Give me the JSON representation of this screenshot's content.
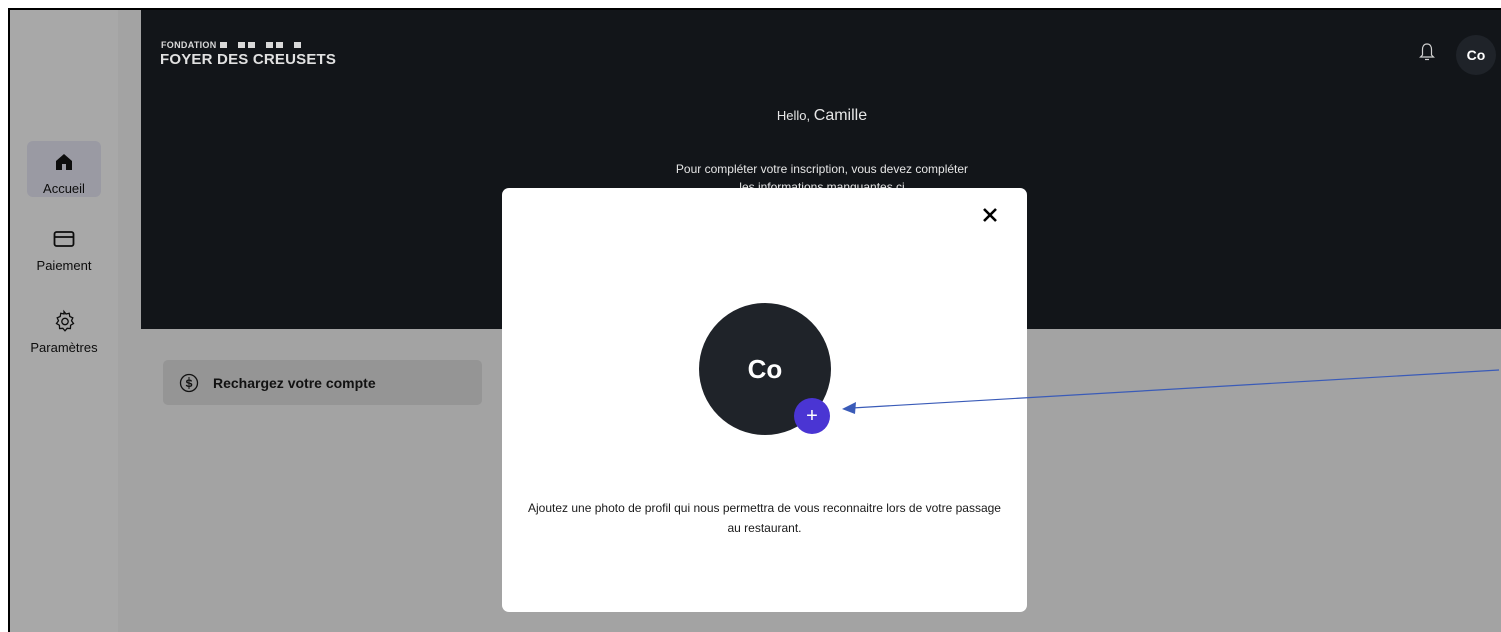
{
  "brand": {
    "top_line": "FONDATION",
    "name": "FOYER DES CREUSETS"
  },
  "header": {
    "greeting_prefix": "Hello,",
    "greeting_name": "Camille",
    "notification_icon": "bell-icon",
    "avatar_initials": "Co",
    "info_text": "Pour compléter votre inscription, vous devez compléter les informations manquantes ci"
  },
  "sidebar": {
    "items": [
      {
        "label": "Accueil",
        "icon": "home-icon",
        "active": true
      },
      {
        "label": "Paiement",
        "icon": "card-icon",
        "active": false
      },
      {
        "label": "Paramètres",
        "icon": "gear-icon",
        "active": false
      }
    ]
  },
  "main": {
    "reload_card": {
      "label": "Rechargez votre compte",
      "icon": "dollar-circle-icon"
    }
  },
  "modal": {
    "close_icon": "close-icon",
    "avatar_initials": "Co",
    "add_photo_icon": "plus-icon",
    "description": "Ajoutez une photo de profil qui nous permettra de vous reconnaitre lors de votre passage au restaurant."
  },
  "annotation": {
    "arrow_color": "#3a5bb8"
  },
  "colors": {
    "header_bg": "#121519",
    "overlay_bg": "#a3a3a3",
    "accent": "#4a35d3"
  }
}
